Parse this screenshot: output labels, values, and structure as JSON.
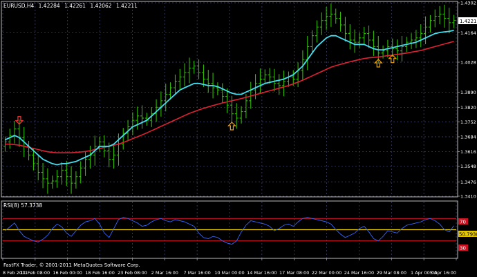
{
  "window": {
    "symbol_line": {
      "symbol": "EURUSD,H4",
      "open": "1.42284",
      "high": "1.42261",
      "low": "1.42062",
      "close": "1.42211"
    },
    "current_price": "1.42211"
  },
  "rsi_panel": {
    "label": "RSI(8) 57.3738",
    "current_value": "50.7938",
    "level_high": "70",
    "level_low": "30"
  },
  "copyright": "FastFX Trader, © 2001-2011 MetaQuotes Software Corp.",
  "colors": {
    "background": "#000000",
    "candle": "#33cc00",
    "ma_fast": "#44ddee",
    "ma_slow": "#dd2233",
    "rsi_line": "#3366ff",
    "rsi_level": "#cc1122",
    "rsi_mid": "#e6c800",
    "grid": "#4a4a7a",
    "axis_text": "#ffffff",
    "arrow_up": "#f0a000",
    "arrow_down": "#ff3333",
    "border": "#bbbbbb"
  },
  "chart_data": [
    {
      "type": "line",
      "title": "EURUSD,H4",
      "y_ticks": [
        "1.4302",
        "1.4164",
        "1.4028",
        "1.3890",
        "1.3820",
        "1.3752",
        "1.3684",
        "1.3616",
        "1.3548",
        "1.3476",
        "1.3410"
      ],
      "x_ticks": [
        "8 Feb 2011",
        "11 Feb 08:00",
        "16 Feb 00:00",
        "18 Feb 16:00",
        "23 Feb 08:00",
        "2 Mar 16:00",
        "7 Mar 16:00",
        "10 Mar 00:00",
        "14 Mar 16:00",
        "17 Mar 08:00",
        "22 Mar 00:00",
        "24 Mar 16:00",
        "29 Mar 08:00",
        "1 Apr 00:00",
        "5 Apr 16:00"
      ],
      "ylim": [
        1.341,
        1.4302
      ],
      "grid": true,
      "series": [
        {
          "values": [
            1.366,
            1.369,
            1.372,
            1.368,
            1.364,
            1.36,
            1.356,
            1.352,
            1.349,
            1.347,
            1.348,
            1.35,
            1.353,
            1.35,
            1.347,
            1.35,
            1.354,
            1.358,
            1.36,
            1.364,
            1.366,
            1.362,
            1.358,
            1.36,
            1.365,
            1.37,
            1.373,
            1.376,
            1.378,
            1.377,
            1.376,
            1.379,
            1.382,
            1.385,
            1.388,
            1.391,
            1.394,
            1.396,
            1.398,
            1.4,
            1.401,
            1.398,
            1.395,
            1.393,
            1.391,
            1.39,
            1.387,
            1.383,
            1.379,
            1.377,
            1.38,
            1.385,
            1.39,
            1.393,
            1.395,
            1.397,
            1.396,
            1.393,
            1.392,
            1.394,
            1.396,
            1.395,
            1.399,
            1.404,
            1.41,
            1.415,
            1.419,
            1.422,
            1.424,
            1.425,
            1.423,
            1.42,
            1.416,
            1.413,
            1.412,
            1.414,
            1.416,
            1.413,
            1.41,
            1.407,
            1.408,
            1.41,
            1.409,
            1.408,
            1.41,
            1.412,
            1.413,
            1.414,
            1.416,
            1.419,
            1.422,
            1.424,
            1.425,
            1.423,
            1.421,
            1.4221
          ]
        },
        {
          "values": [
            1.367,
            1.368,
            1.369,
            1.368,
            1.366,
            1.364,
            1.362,
            1.36,
            1.358,
            1.357,
            1.356,
            1.3555,
            1.356,
            1.356,
            1.3565,
            1.357,
            1.358,
            1.359,
            1.36,
            1.362,
            1.364,
            1.364,
            1.364,
            1.365,
            1.367,
            1.369,
            1.371,
            1.373,
            1.374,
            1.375,
            1.376,
            1.378,
            1.38,
            1.382,
            1.384,
            1.386,
            1.388,
            1.39,
            1.391,
            1.392,
            1.393,
            1.393,
            1.3925,
            1.392,
            1.392,
            1.3915,
            1.3905,
            1.3895,
            1.3885,
            1.388,
            1.388,
            1.389,
            1.39,
            1.391,
            1.392,
            1.393,
            1.3935,
            1.394,
            1.3945,
            1.395,
            1.396,
            1.397,
            1.399,
            1.401,
            1.404,
            1.407,
            1.41,
            1.412,
            1.414,
            1.415,
            1.415,
            1.414,
            1.413,
            1.412,
            1.411,
            1.411,
            1.411,
            1.41,
            1.409,
            1.4085,
            1.4085,
            1.409,
            1.4095,
            1.41,
            1.4105,
            1.411,
            1.4115,
            1.412,
            1.413,
            1.414,
            1.415,
            1.416,
            1.4165,
            1.4168,
            1.417,
            1.4175
          ]
        },
        {
          "values": [
            1.365,
            1.365,
            1.3648,
            1.3645,
            1.364,
            1.3635,
            1.363,
            1.3625,
            1.362,
            1.3615,
            1.3612,
            1.361,
            1.361,
            1.361,
            1.361,
            1.3612,
            1.3614,
            1.3616,
            1.362,
            1.3625,
            1.363,
            1.3635,
            1.364,
            1.3645,
            1.365,
            1.3658,
            1.3666,
            1.3675,
            1.3684,
            1.3693,
            1.3702,
            1.3712,
            1.3722,
            1.3732,
            1.3742,
            1.3752,
            1.3762,
            1.3772,
            1.3782,
            1.3792,
            1.38,
            1.3808,
            1.3815,
            1.3822,
            1.3828,
            1.3834,
            1.384,
            1.3845,
            1.385,
            1.3855,
            1.386,
            1.3866,
            1.3872,
            1.3878,
            1.3884,
            1.389,
            1.3896,
            1.3902,
            1.3908,
            1.3914,
            1.392,
            1.3928,
            1.3936,
            1.3945,
            1.3955,
            1.3965,
            1.3975,
            1.3985,
            1.3995,
            1.4005,
            1.4012,
            1.4018,
            1.4024,
            1.403,
            1.4035,
            1.404,
            1.4045,
            1.4048,
            1.405,
            1.4052,
            1.4055,
            1.4058,
            1.4061,
            1.4064,
            1.4067,
            1.407,
            1.4074,
            1.4078,
            1.4082,
            1.4088,
            1.4094,
            1.41,
            1.4106,
            1.4112,
            1.4118,
            1.4124
          ]
        }
      ]
    },
    {
      "type": "line",
      "title": "RSI(8) 57.3738",
      "y_ticks": [
        "70",
        "30"
      ],
      "ylim": [
        0,
        100
      ],
      "levels": [
        70,
        50,
        30
      ],
      "grid": true,
      "series": [
        {
          "values": [
            48,
            55,
            62,
            48,
            38,
            34,
            30,
            28,
            33,
            40,
            52,
            60,
            55,
            44,
            38,
            48,
            58,
            64,
            66,
            70,
            60,
            44,
            36,
            52,
            68,
            72,
            70,
            66,
            62,
            56,
            58,
            64,
            68,
            70,
            66,
            64,
            68,
            66,
            64,
            60,
            56,
            44,
            36,
            34,
            38,
            36,
            30,
            26,
            24,
            30,
            46,
            58,
            66,
            64,
            62,
            60,
            56,
            48,
            52,
            58,
            60,
            56,
            64,
            70,
            72,
            70,
            68,
            66,
            64,
            60,
            50,
            42,
            36,
            40,
            44,
            52,
            56,
            46,
            34,
            30,
            38,
            48,
            46,
            44,
            52,
            58,
            60,
            62,
            64,
            68,
            70,
            66,
            60,
            50,
            46,
            57
          ]
        }
      ]
    }
  ]
}
